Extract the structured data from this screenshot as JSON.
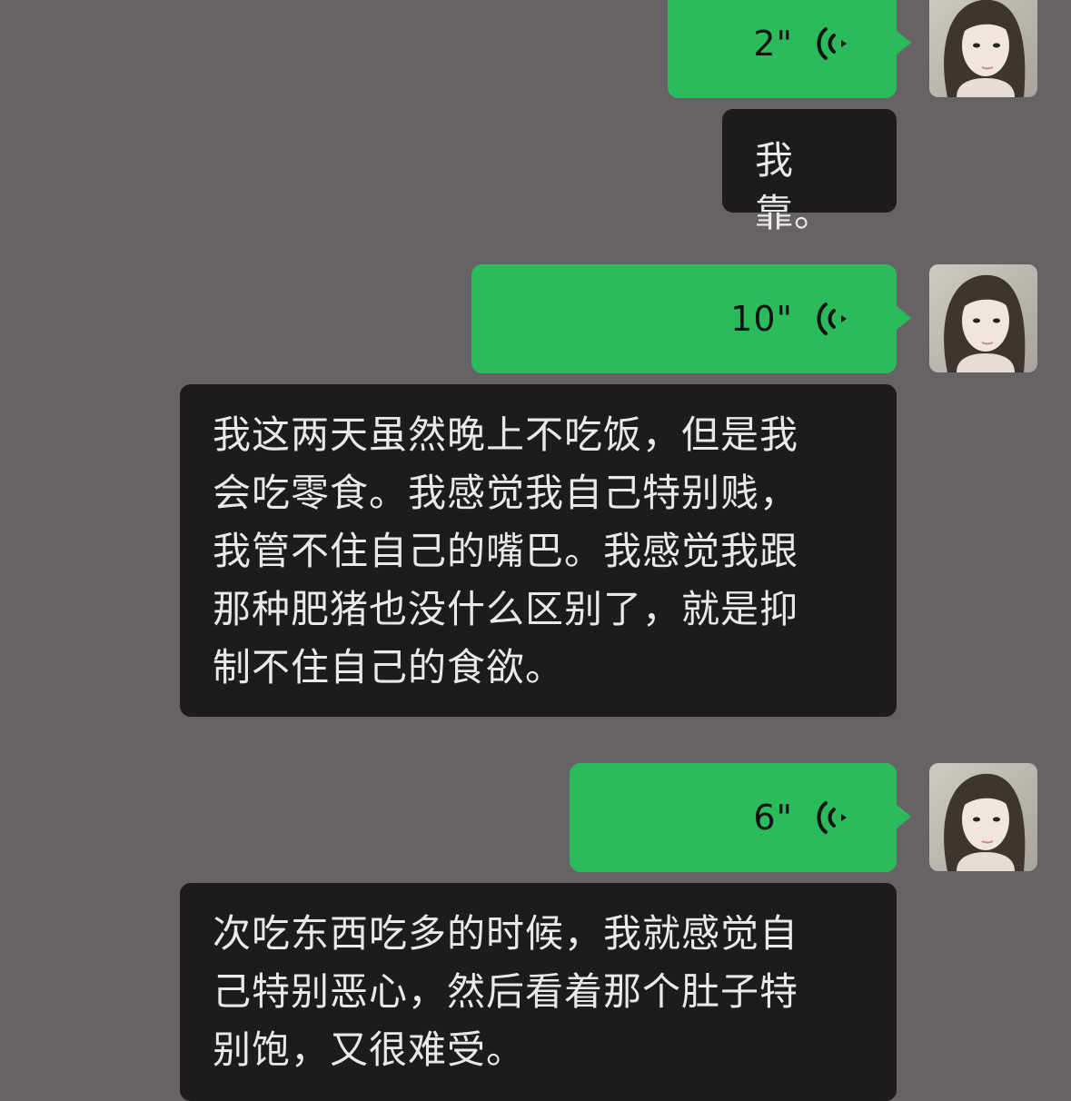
{
  "messages": [
    {
      "type": "voice",
      "duration": "2\""
    },
    {
      "type": "text",
      "text": "我靠。"
    },
    {
      "type": "voice",
      "duration": "10\""
    },
    {
      "type": "text",
      "text": "我这两天虽然晚上不吃饭，但是我\n会吃零食。我感觉我自己特别贱，\n我管不住自己的嘴巴。我感觉我跟\n那种肥猪也没什么区别了，就是抑\n制不住自己的食欲。"
    },
    {
      "type": "voice",
      "duration": "6\""
    },
    {
      "type": "text",
      "text": "次吃东西吃多的时候，我就感觉自\n己特别恶心，然后看着那个肚子特\n别饱，又很难受。"
    }
  ],
  "icons": {
    "voice": "voice-wave-icon",
    "avatar": "user-avatar"
  },
  "colors": {
    "background": "#676365",
    "voice_bubble": "#2bbb5c",
    "text_bubble": "#1c1c1c",
    "text": "#e9e9e9"
  }
}
